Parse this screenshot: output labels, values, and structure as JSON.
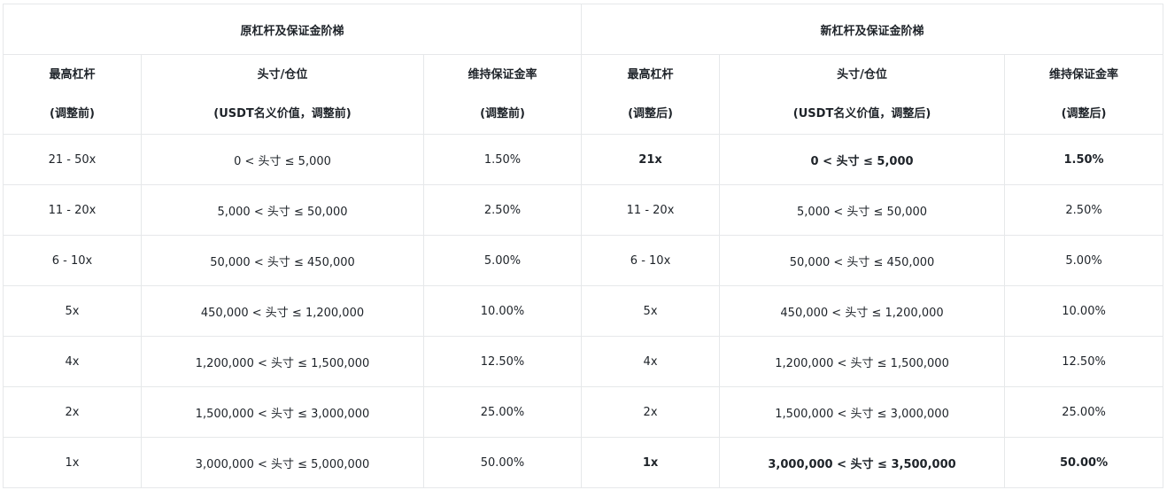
{
  "groups": {
    "old": "原杠杆及保证金阶梯",
    "new": "新杠杆及保证金阶梯"
  },
  "columns": [
    {
      "line1": "最高杠杆",
      "line2": "(调整前)"
    },
    {
      "line1": "头寸/仓位",
      "line2": "(USDT名义价值，调整前)"
    },
    {
      "line1": "维持保证金率",
      "line2": "(调整前)"
    },
    {
      "line1": "最高杠杆",
      "line2": "(调整后)"
    },
    {
      "line1": "头寸/仓位",
      "line2": "(USDT名义价值，调整后)"
    },
    {
      "line1": "维持保证金率",
      "line2": "(调整后)"
    }
  ],
  "rows": [
    {
      "cells": [
        "21 - 50x",
        "0 < 头寸 ≤ 5,000",
        "1.50%",
        "21x",
        "0 < 头寸 ≤ 5,000",
        "1.50%"
      ],
      "new_bold": true
    },
    {
      "cells": [
        "11 - 20x",
        "5,000 < 头寸 ≤ 50,000",
        "2.50%",
        "11 - 20x",
        "5,000 < 头寸 ≤ 50,000",
        "2.50%"
      ],
      "new_bold": false
    },
    {
      "cells": [
        "6 - 10x",
        "50,000 < 头寸 ≤ 450,000",
        "5.00%",
        "6 - 10x",
        "50,000 < 头寸 ≤ 450,000",
        "5.00%"
      ],
      "new_bold": false
    },
    {
      "cells": [
        "5x",
        "450,000 < 头寸 ≤ 1,200,000",
        "10.00%",
        "5x",
        "450,000 < 头寸 ≤ 1,200,000",
        "10.00%"
      ],
      "new_bold": false
    },
    {
      "cells": [
        "4x",
        "1,200,000 < 头寸 ≤ 1,500,000",
        "12.50%",
        "4x",
        "1,200,000 < 头寸 ≤ 1,500,000",
        "12.50%"
      ],
      "new_bold": false
    },
    {
      "cells": [
        "2x",
        "1,500,000 < 头寸 ≤ 3,000,000",
        "25.00%",
        "2x",
        "1,500,000 < 头寸 ≤ 3,000,000",
        "25.00%"
      ],
      "new_bold": false
    },
    {
      "cells": [
        "1x",
        "3,000,000 < 头寸 ≤ 5,000,000",
        "50.00%",
        "1x",
        "3,000,000 < 头寸 ≤ 3,500,000",
        "50.00%"
      ],
      "new_bold": true
    }
  ]
}
